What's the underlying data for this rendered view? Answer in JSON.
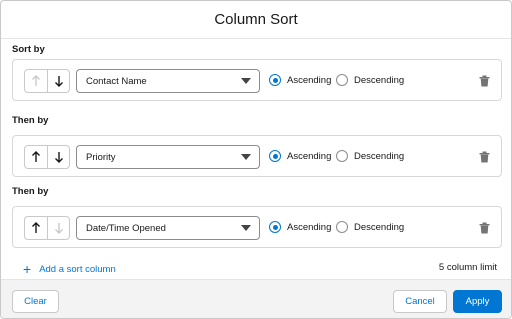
{
  "modal": {
    "title": "Column Sort"
  },
  "rows": [
    {
      "group_label": "Sort by",
      "up_enabled": false,
      "down_enabled": true,
      "field": "Contact Name",
      "ascending_label": "Ascending",
      "descending_label": "Descending",
      "selected": "ascending"
    },
    {
      "group_label": "Then by",
      "up_enabled": true,
      "down_enabled": true,
      "field": "Priority",
      "ascending_label": "Ascending",
      "descending_label": "Descending",
      "selected": "ascending"
    },
    {
      "group_label": "Then by",
      "up_enabled": true,
      "down_enabled": false,
      "field": "Date/Time Opened",
      "ascending_label": "Ascending",
      "descending_label": "Descending",
      "selected": "ascending"
    }
  ],
  "add_column": {
    "label": "Add a sort column",
    "icon": "plus-icon"
  },
  "column_limit": "5 column limit",
  "footer": {
    "clear_label": "Clear",
    "cancel_label": "Cancel",
    "apply_label": "Apply"
  },
  "colors": {
    "brand": "#0176d3",
    "disabled": "#c9c9c9",
    "text": "#181818"
  }
}
